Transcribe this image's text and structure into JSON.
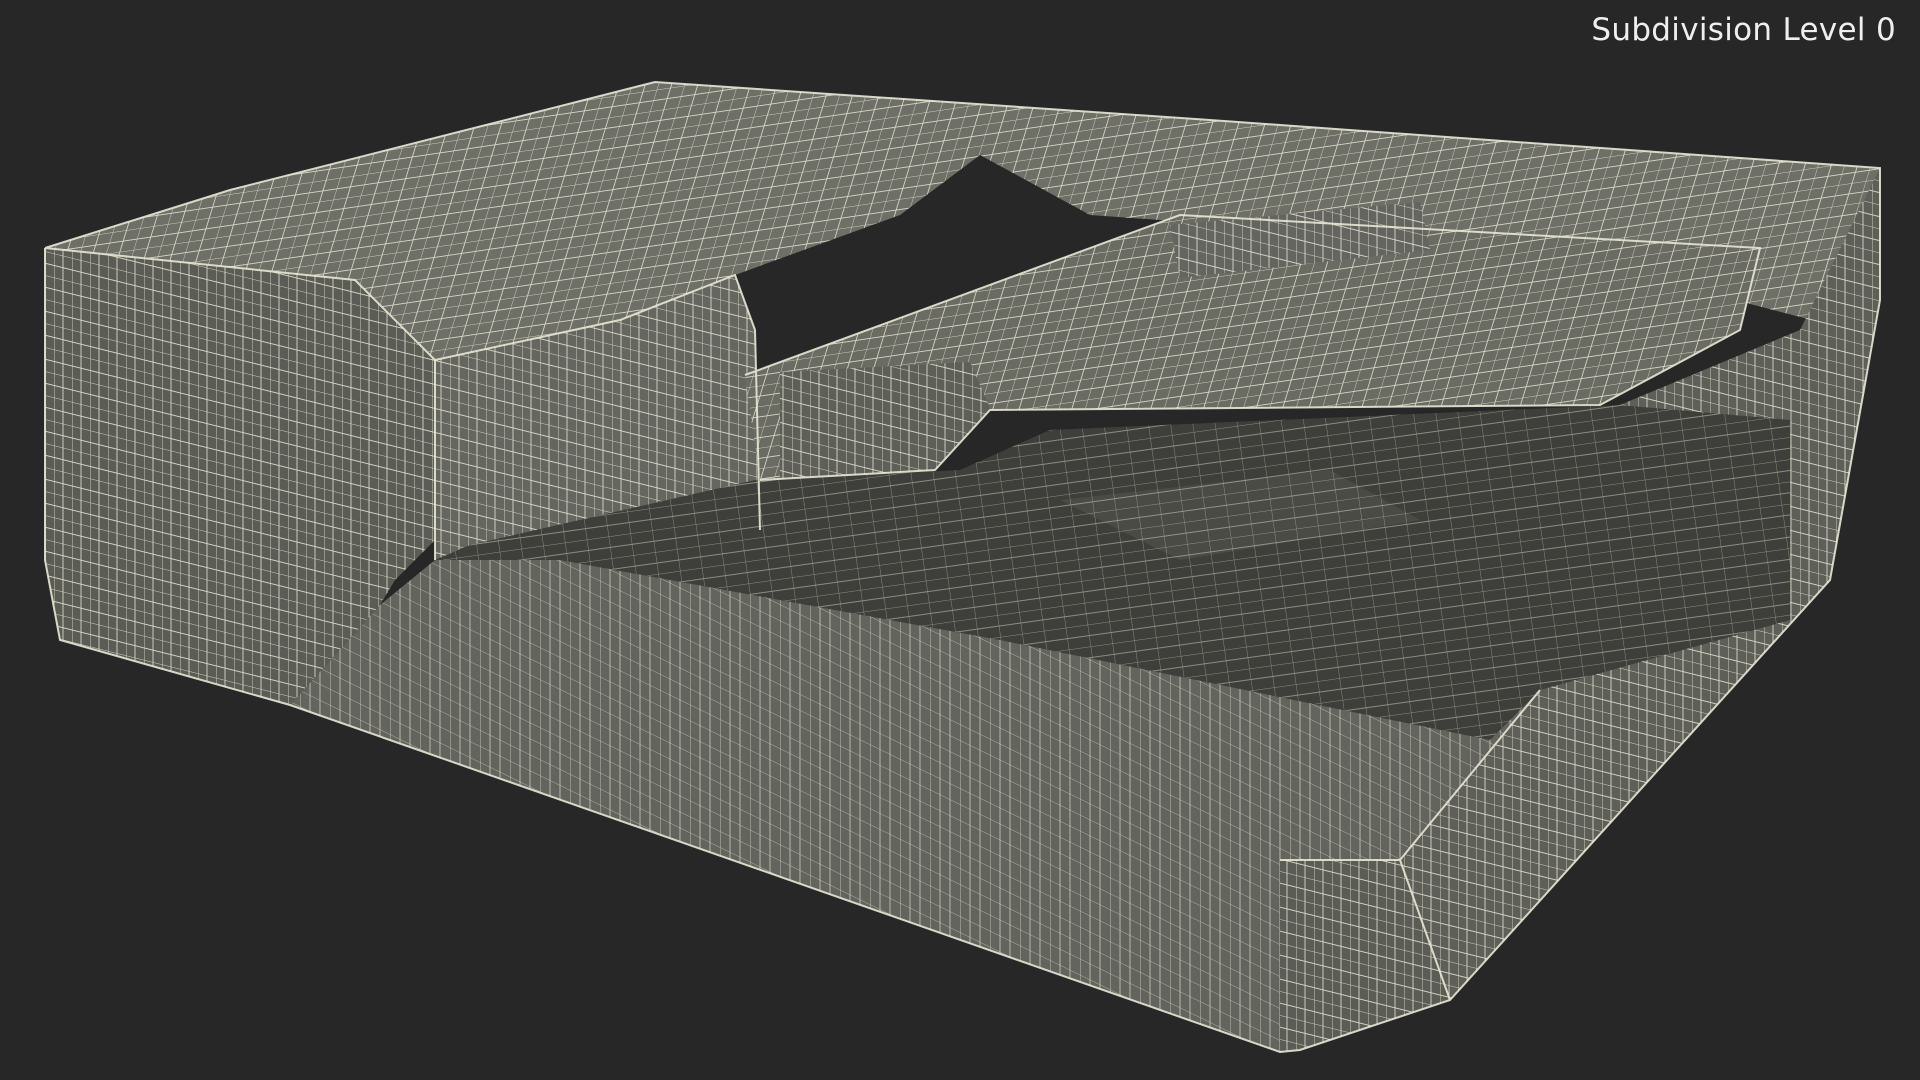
{
  "overlay": {
    "label": "Subdivision Level 0"
  },
  "scene": {
    "subject": "document-feeder-wireframe-model",
    "colors": {
      "background": "#272727",
      "shade_top": "#6e6f67",
      "shade_side": "#5b5c55",
      "shade_dark": "#3e3f3a",
      "shade_mid": "#65665f",
      "wire": "#e9e7d5"
    }
  }
}
